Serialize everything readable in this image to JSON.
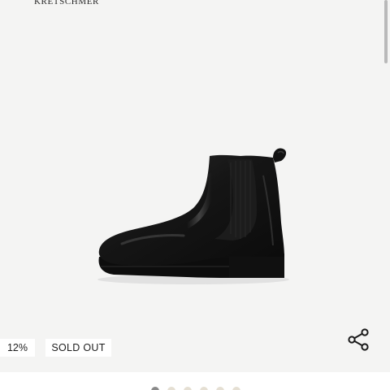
{
  "brand": {
    "name": "KRETSCHMER"
  },
  "product": {
    "discount_label": "12%",
    "status_label": "SOLD OUT"
  },
  "icons": {
    "share": "share-icon"
  },
  "carousel": {
    "dot_count": 6,
    "active_index": 0,
    "colors": {
      "active": "#8a8a8a",
      "inactive": "#e5dfd3"
    }
  },
  "colors": {
    "stage_background": "#f4f4f3",
    "badge_background": "#ffffff",
    "text": "#1e1e1e"
  }
}
